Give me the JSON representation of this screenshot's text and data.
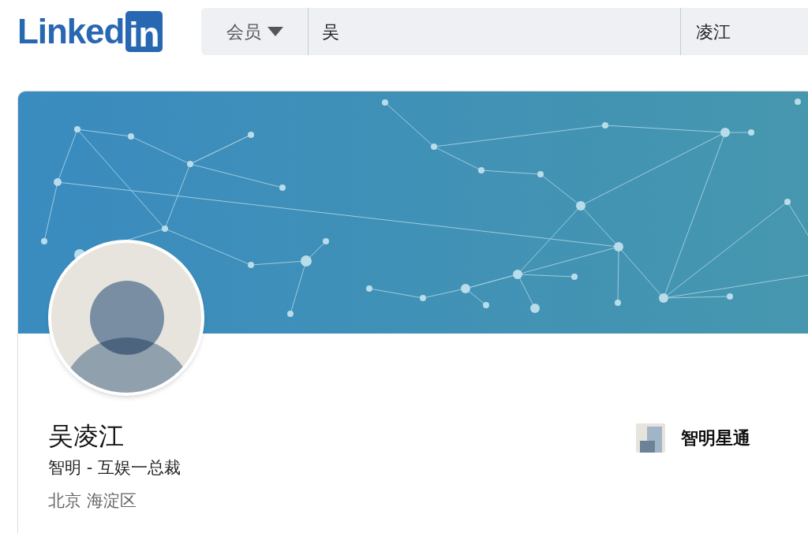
{
  "logo": {
    "word": "Linked",
    "badge": "in"
  },
  "search": {
    "category": "会员",
    "first_name": "吴",
    "last_name": "凌江"
  },
  "profile": {
    "name": "吴凌江",
    "headline": "智明 - 互娱一总裁",
    "location": "北京 海淀区",
    "company": "智明星通"
  }
}
